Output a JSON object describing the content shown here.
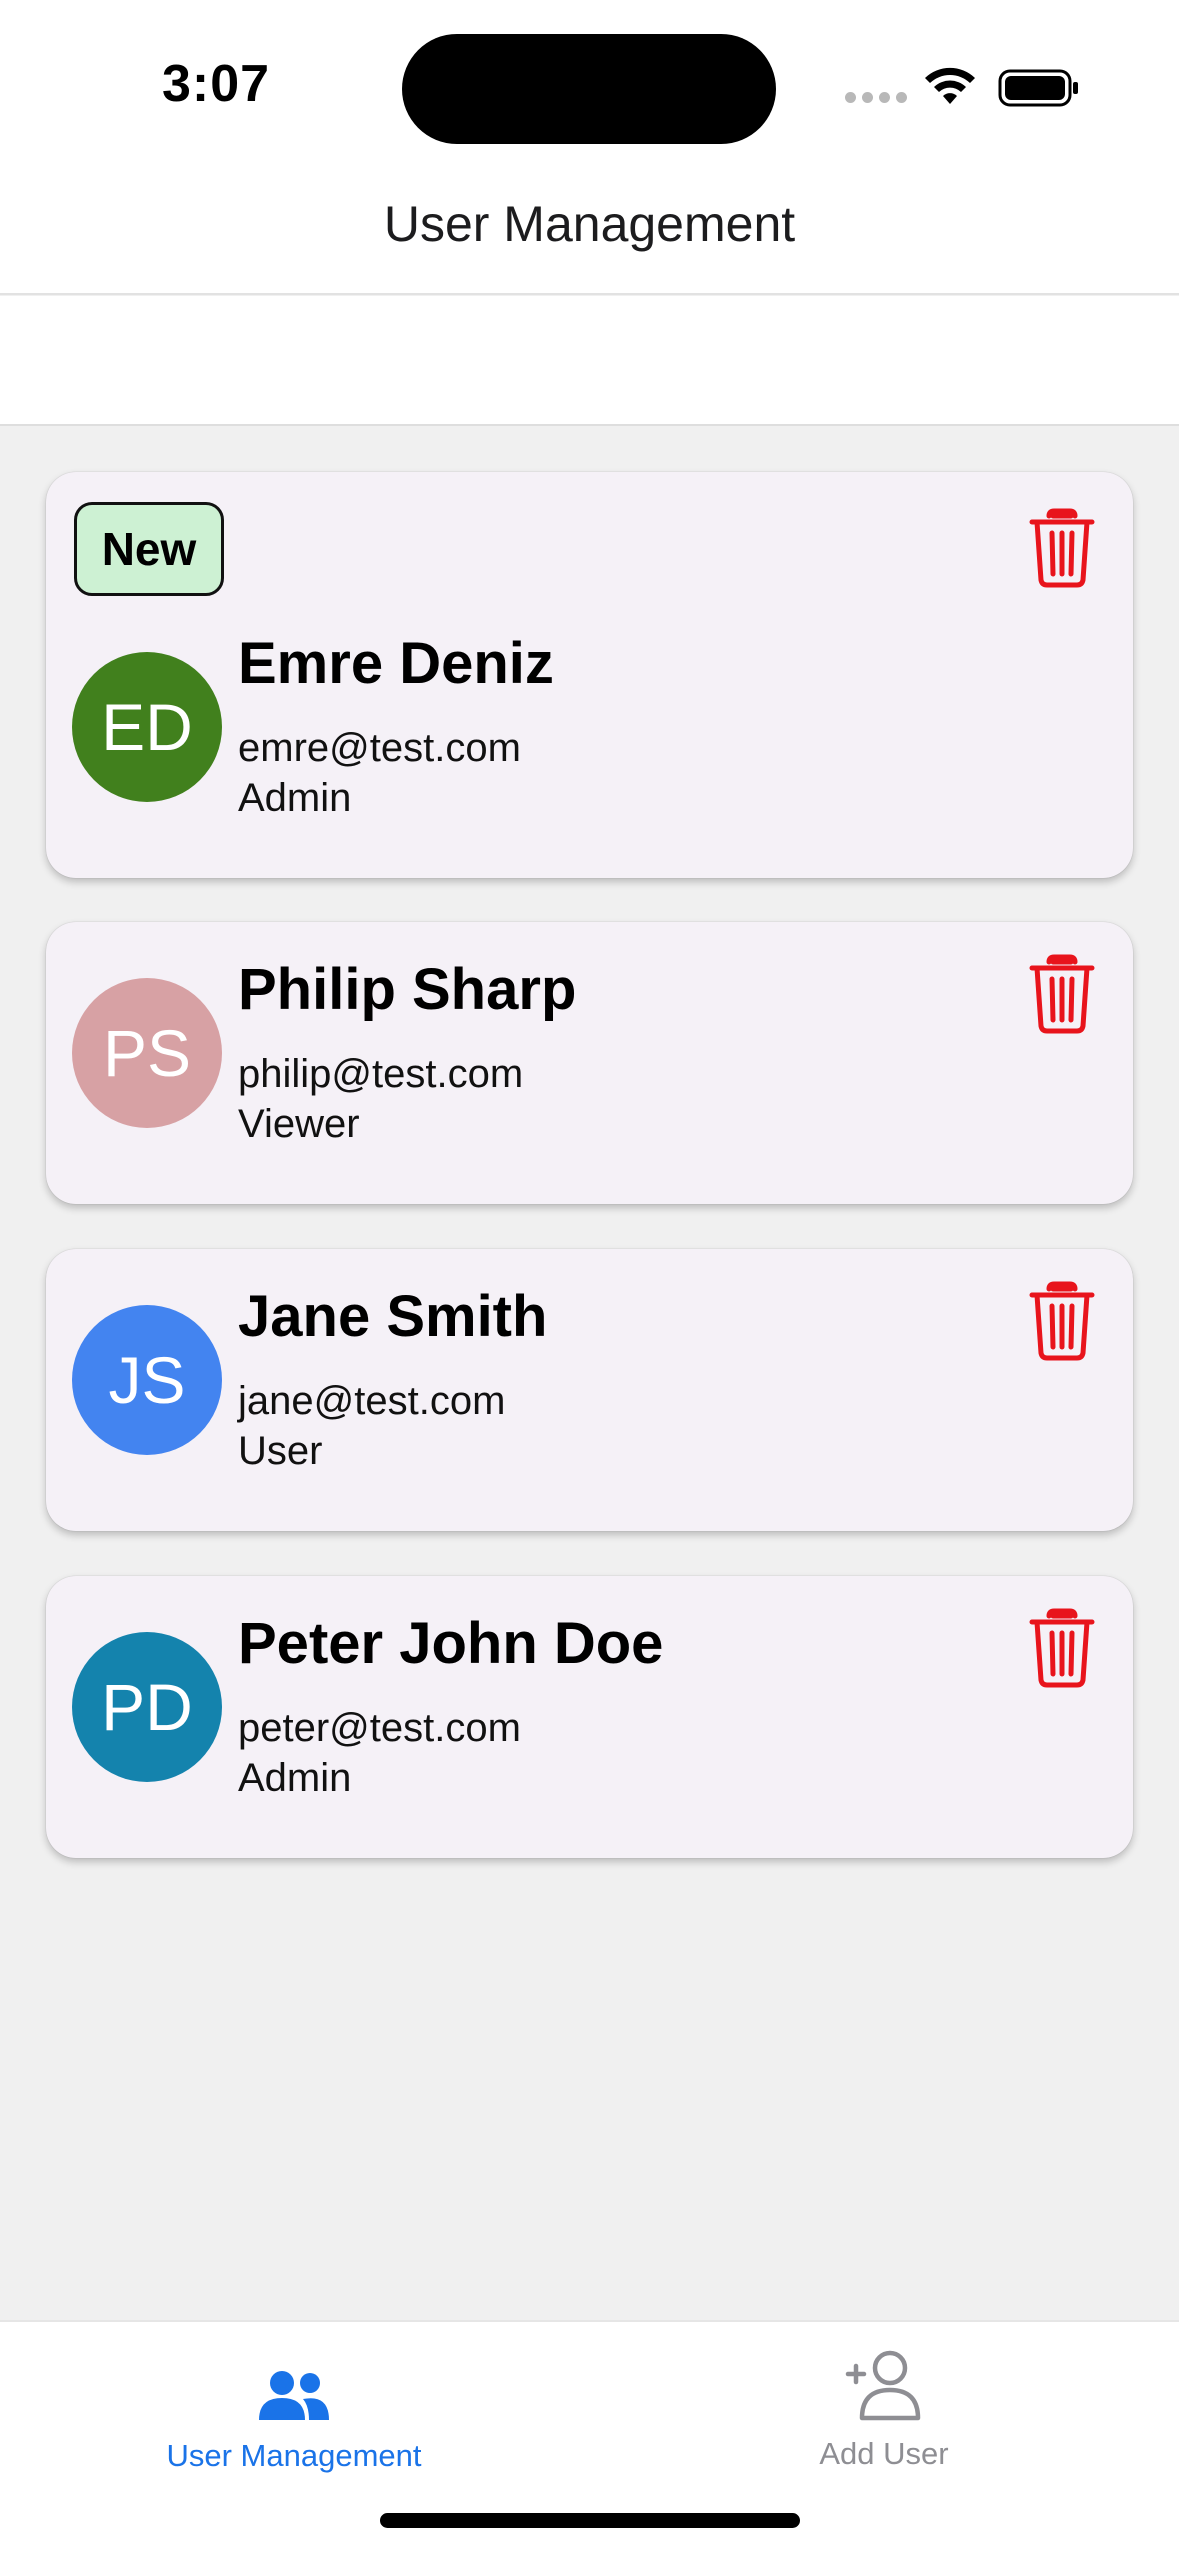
{
  "status_bar": {
    "time": "3:07"
  },
  "header": {
    "title": "User Management"
  },
  "users": [
    {
      "initials": "ED",
      "name": "Emre Deniz",
      "email": "emre@test.com",
      "role": "Admin",
      "badge": "New",
      "avatar_color": "#41801d"
    },
    {
      "initials": "PS",
      "name": "Philip Sharp",
      "email": "philip@test.com",
      "role": "Viewer",
      "avatar_color": "#d7a1a4"
    },
    {
      "initials": "JS",
      "name": "Jane Smith",
      "email": "jane@test.com",
      "role": "User",
      "avatar_color": "#4384f0"
    },
    {
      "initials": "PD",
      "name": "Peter John Doe",
      "email": "peter@test.com",
      "role": "Admin",
      "avatar_color": "#1483ad"
    }
  ],
  "tabs": [
    {
      "label": "User Management",
      "icon": "users-icon",
      "active": true
    },
    {
      "label": "Add User",
      "icon": "add-user-icon",
      "active": false
    }
  ],
  "colors": {
    "accent": "#1a73e8",
    "delete": "#e8141c",
    "badge_bg": "#cdf1d3",
    "card_bg": "#f5f1f7"
  }
}
